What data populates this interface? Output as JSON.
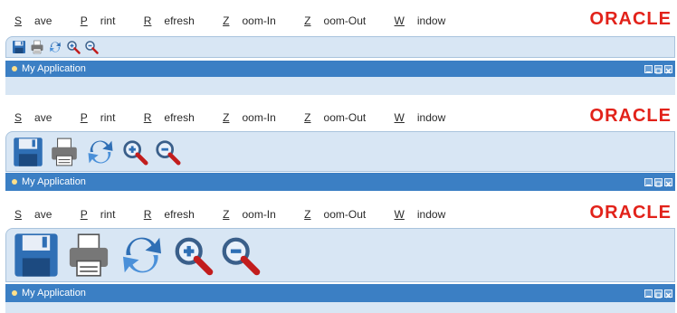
{
  "menu": [
    {
      "label": "Save",
      "accel": "S",
      "rest": "ave"
    },
    {
      "label": "Print",
      "accel": "P",
      "rest": "rint"
    },
    {
      "label": "Refresh",
      "accel": "R",
      "rest": "efresh"
    },
    {
      "label": "Zoom-In",
      "accel": "Z",
      "rest": "oom-In"
    },
    {
      "label": "Zoom-Out",
      "accel": "Z",
      "rest": "oom-Out"
    },
    {
      "label": "Window",
      "accel": "W",
      "rest": "indow"
    }
  ],
  "logo_text": "ORACLE",
  "window_title": "My Application",
  "toolbar_icons": [
    "save-icon",
    "print-icon",
    "refresh-icon",
    "zoom-in-icon",
    "zoom-out-icon"
  ],
  "window_buttons": [
    "minimize-icon",
    "maximize-icon",
    "close-icon"
  ],
  "colors": {
    "accent": "#3b7fc4",
    "toolbar_bg": "#d8e6f4",
    "logo": "#e2221a"
  }
}
